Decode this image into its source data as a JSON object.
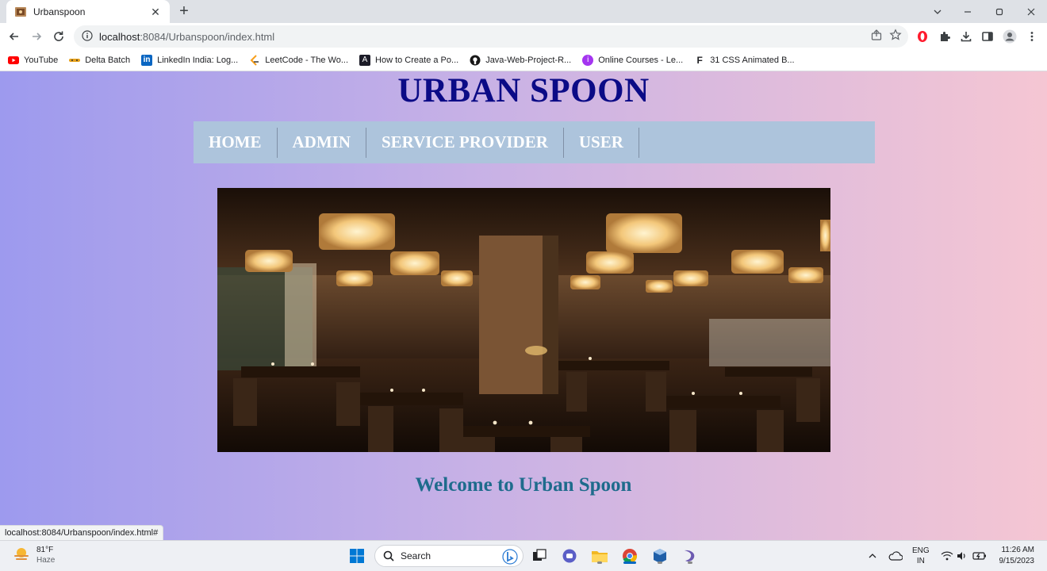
{
  "browser": {
    "tab_title": "Urbanspoon",
    "url_host": "localhost",
    "url_rest": ":8084/Urbanspoon/index.html",
    "bookmarks": [
      {
        "label": "YouTube",
        "icon": "youtube-icon",
        "color": "#ff0000"
      },
      {
        "label": "Delta Batch",
        "icon": "delta-icon",
        "color": "#e8a21a"
      },
      {
        "label": "LinkedIn India: Log...",
        "icon": "linkedin-icon",
        "color": "#0a66c2"
      },
      {
        "label": "LeetCode - The Wo...",
        "icon": "leetcode-icon",
        "color": "#f89f1b"
      },
      {
        "label": "How to Create a Po...",
        "icon": "code-icon",
        "color": "#1c1c28"
      },
      {
        "label": "Java-Web-Project-R...",
        "icon": "github-icon",
        "color": "#181717"
      },
      {
        "label": "Online Courses - Le...",
        "icon": "courses-icon",
        "color": "#a435f0"
      },
      {
        "label": "31 CSS Animated B...",
        "icon": "css-icon",
        "color": "#202124"
      }
    ],
    "status_url": "localhost:8084/Urbanspoon/index.html#"
  },
  "site": {
    "title": "URBAN SPOON",
    "nav": [
      "HOME",
      "ADMIN",
      "SERVICE PROVIDER",
      "USER"
    ],
    "welcome": "Welcome to Urban Spoon",
    "title_color": "#0b0b86",
    "welcome_color": "#1e6b8c",
    "nav_bg": "#adc4dc"
  },
  "taskbar": {
    "weather_temp": "81°F",
    "weather_desc": "Haze",
    "search_label": "Search",
    "lang_top": "ENG",
    "lang_bottom": "IN",
    "time": "11:26 AM",
    "date": "9/15/2023"
  }
}
